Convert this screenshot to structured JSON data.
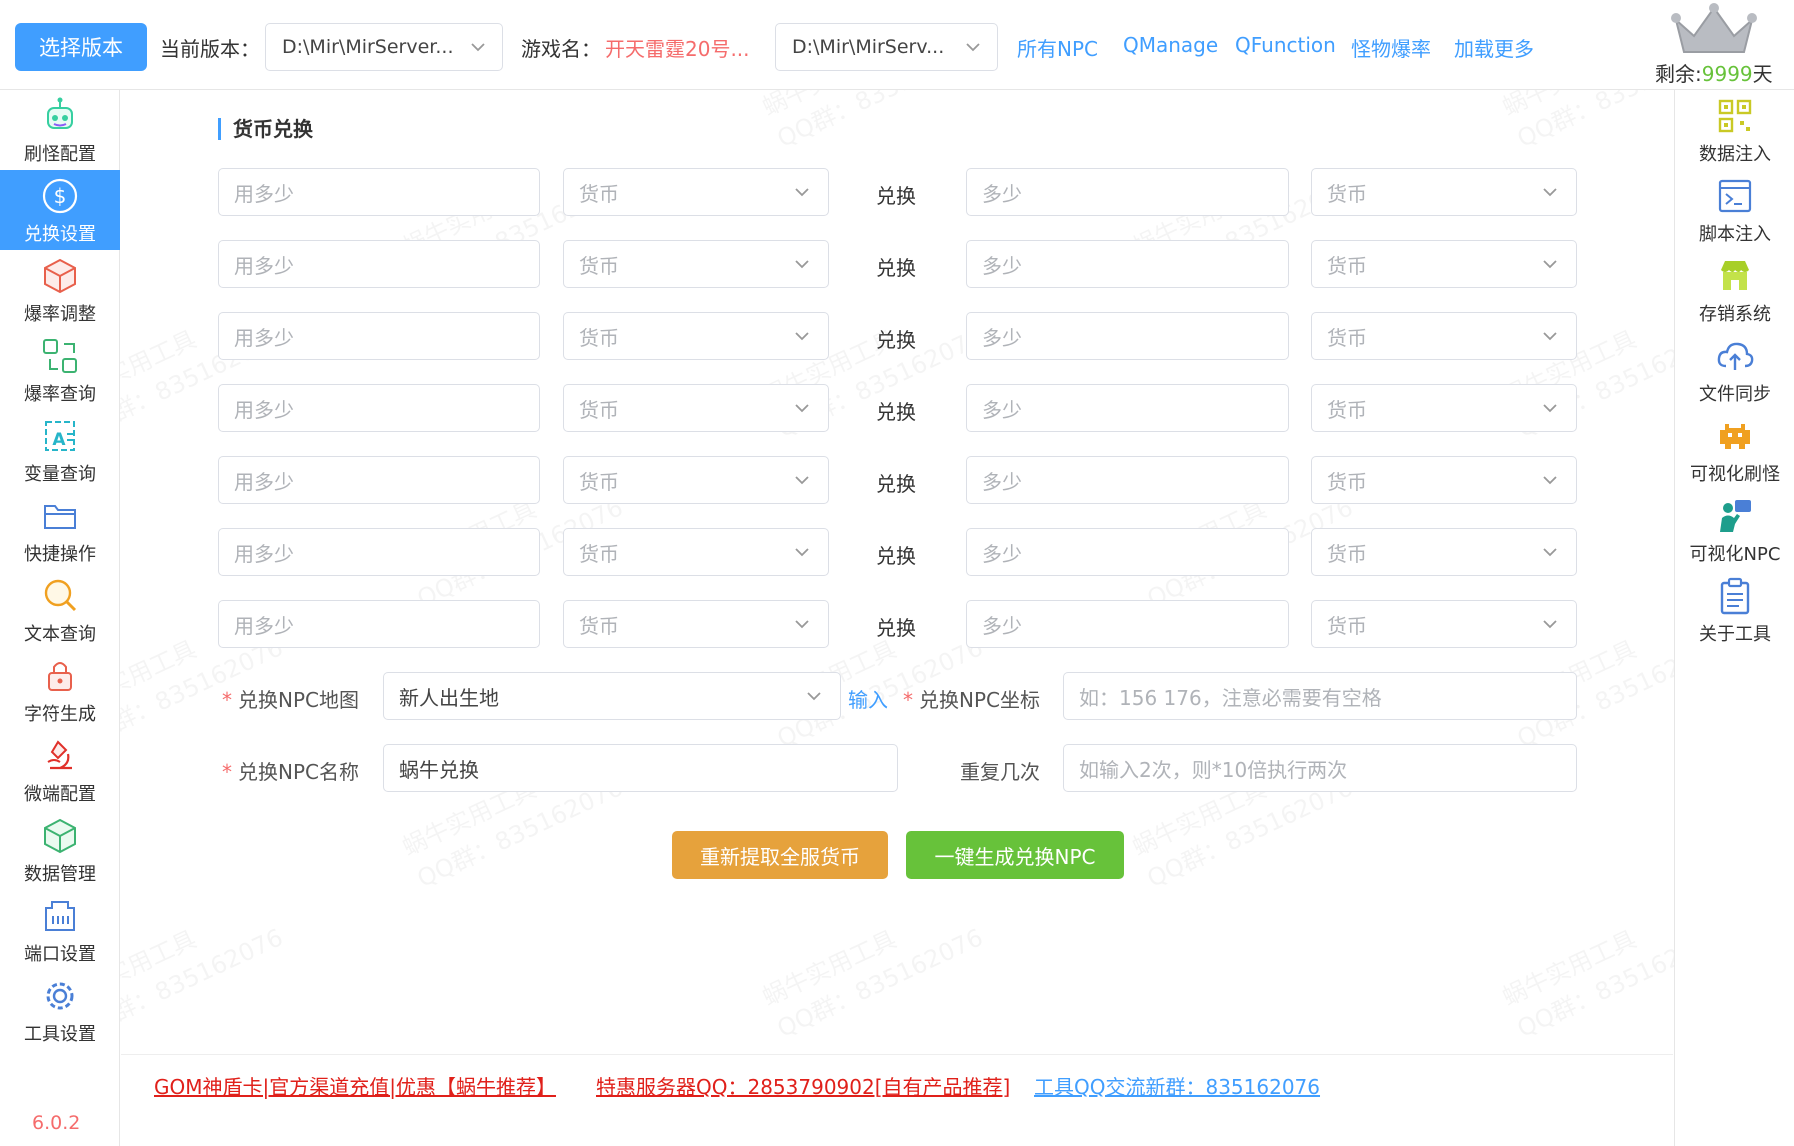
{
  "topbar": {
    "select_version_label": "选择版本",
    "current_version_label": "当前版本：",
    "current_version_value": "D:\\Mir\\MirServer...",
    "game_name_label": "游戏名：",
    "game_name_value": "开天雷霆20号...",
    "path_select_value": "D:\\Mir\\MirServ...",
    "links": [
      "所有NPC",
      "QManage",
      "QFunction",
      "怪物爆率",
      "加载更多"
    ],
    "remaining_prefix": "剩余:",
    "remaining_days": "9999",
    "remaining_suffix": "天"
  },
  "left_nav": [
    {
      "label": "刷怪配置",
      "icon": "robot-icon",
      "active": false
    },
    {
      "label": "兑换设置",
      "icon": "dollar-icon",
      "active": true
    },
    {
      "label": "爆率调整",
      "icon": "cube-icon",
      "active": false
    },
    {
      "label": "爆率查询",
      "icon": "swap-icon",
      "active": false
    },
    {
      "label": "变量查询",
      "icon": "variable-icon",
      "active": false
    },
    {
      "label": "快捷操作",
      "icon": "folder-icon",
      "active": false
    },
    {
      "label": "文本查询",
      "icon": "search-icon",
      "active": false
    },
    {
      "label": "字符生成",
      "icon": "lock-icon",
      "active": false
    },
    {
      "label": "微端配置",
      "icon": "microscope-icon",
      "active": false
    },
    {
      "label": "数据管理",
      "icon": "box-icon",
      "active": false
    },
    {
      "label": "端口设置",
      "icon": "port-icon",
      "active": false
    },
    {
      "label": "工具设置",
      "icon": "gear-icon",
      "active": false
    }
  ],
  "version": "6.0.2",
  "right_nav": [
    {
      "label": "数据注入",
      "icon": "qrcode-icon"
    },
    {
      "label": "脚本注入",
      "icon": "terminal-icon"
    },
    {
      "label": "存销系统",
      "icon": "store-icon"
    },
    {
      "label": "文件同步",
      "icon": "cloud-upload-icon"
    },
    {
      "label": "可视化刷怪",
      "icon": "invader-icon"
    },
    {
      "label": "可视化NPC",
      "icon": "presenter-icon"
    },
    {
      "label": "关于工具",
      "icon": "clipboard-icon"
    }
  ],
  "section_title": "货币兑换",
  "exchange_row": {
    "use_placeholder": "用多少",
    "currency_placeholder": "货币",
    "exchange_label": "兑换",
    "amount_placeholder": "多少"
  },
  "form": {
    "npc_map_label": "兑换NPC地图",
    "npc_map_value": "新人出生地",
    "input_link": "输入",
    "npc_coord_label": "兑换NPC坐标",
    "npc_coord_placeholder": "如：156 176，注意必需要有空格",
    "npc_name_label": "兑换NPC名称",
    "npc_name_value": "蜗牛兑换",
    "repeat_label": "重复几次",
    "repeat_placeholder": "如输入2次，则*10倍执行两次",
    "required_mark": "*"
  },
  "buttons": {
    "refetch": "重新提取全服货币",
    "generate": "一键生成兑换NPC"
  },
  "footer": {
    "link1": "GOM神盾卡|官方渠道充值|优惠【蜗牛推荐】",
    "link2": "特惠服务器QQ：2853790902[自有产品推荐]",
    "link3": "工具QQ交流新群：835162076"
  },
  "watermark": {
    "line1": "蜗牛实用工具",
    "line2": "QQ群：835162076"
  },
  "colors": {
    "primary": "#409eff",
    "orange": "#e6a23c",
    "green": "#67c23a",
    "danger": "#f56c6c"
  }
}
